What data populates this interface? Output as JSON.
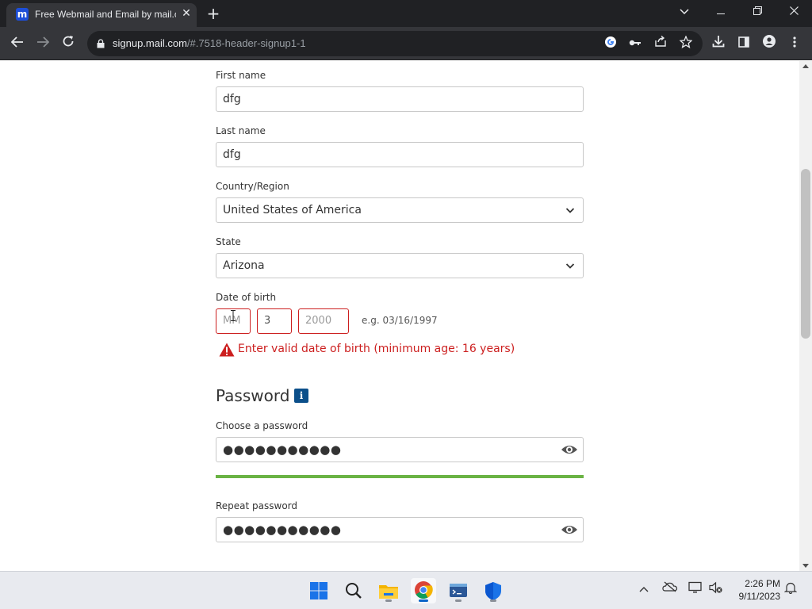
{
  "browser": {
    "tab_title": "Free Webmail and Email by mail.com",
    "favicon_letter": "m",
    "url_host": "signup.mail.com",
    "url_path": "/#.7518-header-signup1-1"
  },
  "form": {
    "first_name": {
      "label": "First name",
      "value": "dfg"
    },
    "last_name": {
      "label": "Last name",
      "value": "dfg"
    },
    "country": {
      "label": "Country/Region",
      "value": "United States of America"
    },
    "state": {
      "label": "State",
      "value": "Arizona"
    },
    "dob": {
      "label": "Date of birth",
      "month_placeholder": "MM",
      "day_value": "3",
      "year_value": "2000",
      "hint": "e.g. 03/16/1997",
      "error": "Enter valid date of birth (minimum age: 16 years)"
    },
    "password": {
      "section_title": "Password",
      "info_glyph": "i",
      "choose_label": "Choose a password",
      "choose_masked": "●●●●●●●●●●●",
      "strength_fraction": 1.0,
      "repeat_label": "Repeat password",
      "repeat_masked": "●●●●●●●●●●●"
    }
  },
  "taskbar": {
    "time": "2:26 PM",
    "date": "9/11/2023"
  },
  "colors": {
    "error": "#cc1f1f",
    "strength_bar": "#6ab344",
    "info_badge": "#0b4f8a",
    "chrome_dark": "#202124"
  }
}
